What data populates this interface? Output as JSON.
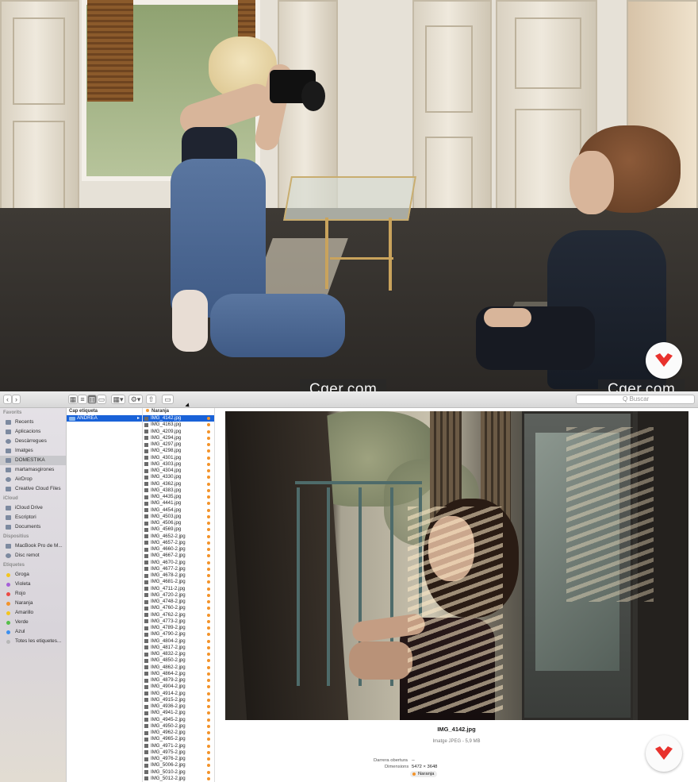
{
  "watermark": {
    "text": "Cger.com"
  },
  "colors": {
    "selection": "#1962d8",
    "tag_orange": "#f3932a",
    "brand_red": "#e8322d"
  },
  "toolbar": {
    "back_icon": "chevron-left-icon",
    "forward_icon": "chevron-right-icon",
    "search_placeholder": "Q Buscar"
  },
  "sidebar": {
    "favorites_header": "Favorits",
    "favorites": [
      "Recents",
      "Aplicacions",
      "Descàrregues",
      "Imatges",
      "DOMESTIKA",
      "martamasgirones",
      "AirDrop",
      "Creative Cloud Files"
    ],
    "selected_favorite": "DOMESTIKA",
    "icloud_header": "iCloud",
    "icloud": [
      "iCloud Drive",
      "Escriptori",
      "Documents"
    ],
    "devices_header": "Dispositius",
    "devices": [
      "MacBook Pro de M...",
      "Disc remot"
    ],
    "tags_header": "Etiquetes",
    "tags": [
      {
        "label": "Groga",
        "color": "#f4c51d"
      },
      {
        "label": "Violeta",
        "color": "#a660d8"
      },
      {
        "label": "Rojo",
        "color": "#ec4a44"
      },
      {
        "label": "Naranja",
        "color": "#f3932a"
      },
      {
        "label": "Amarillo",
        "color": "#f4c51d"
      },
      {
        "label": "Verde",
        "color": "#55be48"
      },
      {
        "label": "Azul",
        "color": "#3c8ff0"
      },
      {
        "label": "Totes les etiquetes...",
        "color": "#b7b7b7"
      }
    ]
  },
  "column1": {
    "header": "Cap etiqueta",
    "folder": "ANDREA"
  },
  "column2": {
    "header": "Naranja",
    "files": [
      "IMG_4142.jpg",
      "IMG_4163.jpg",
      "IMG_4209.jpg",
      "IMG_4294.jpg",
      "IMG_4297.jpg",
      "IMG_4298.jpg",
      "IMG_4301.jpg",
      "IMG_4303.jpg",
      "IMG_4304.jpg",
      "IMG_4330.jpg",
      "IMG_4362.jpg",
      "IMG_4383.jpg",
      "IMG_4435.jpg",
      "IMG_4441.jpg",
      "IMG_4454.jpg",
      "IMG_4503.jpg",
      "IMG_4506.jpg",
      "IMG_4569.jpg",
      "IMG_4652-2.jpg",
      "IMG_4657-2.jpg",
      "IMG_4660-2.jpg",
      "IMG_4667-2.jpg",
      "IMG_4670-2.jpg",
      "IMG_4677-2.jpg",
      "IMG_4678-2.jpg",
      "IMG_4681-2.jpg",
      "IMG_4711-2.jpg",
      "IMG_4720-2.jpg",
      "IMG_4748-2.jpg",
      "IMG_4760-2.jpg",
      "IMG_4762-2.jpg",
      "IMG_4773-2.jpg",
      "IMG_4789-2.jpg",
      "IMG_4790-2.jpg",
      "IMG_4804-2.jpg",
      "IMG_4817-2.jpg",
      "IMG_4832-2.jpg",
      "IMG_4850-2.jpg",
      "IMG_4862-2.jpg",
      "IMG_4864-2.jpg",
      "IMG_4879-2.jpg",
      "IMG_4904-2.jpg",
      "IMG_4914-2.jpg",
      "IMG_4915-2.jpg",
      "IMG_4936-2.jpg",
      "IMG_4941-2.jpg",
      "IMG_4945-2.jpg",
      "IMG_4950-2.jpg",
      "IMG_4962-2.jpg",
      "IMG_4965-2.jpg",
      "IMG_4971-2.jpg",
      "IMG_4975-2.jpg",
      "IMG_4976-2.jpg",
      "IMG_5006-2.jpg",
      "IMG_5010-2.jpg",
      "IMG_5012-2.jpg"
    ],
    "selected_file": "IMG_4142.jpg"
  },
  "preview": {
    "file_name": "IMG_4142.jpg",
    "kind": "Imatge JPEG - 5,9 MB",
    "last_opened_label": "Darrera obertura",
    "last_opened_value": "--",
    "dimensions_label": "Dimensions",
    "dimensions_value": "5472 × 3648",
    "tag": "Naranja"
  }
}
